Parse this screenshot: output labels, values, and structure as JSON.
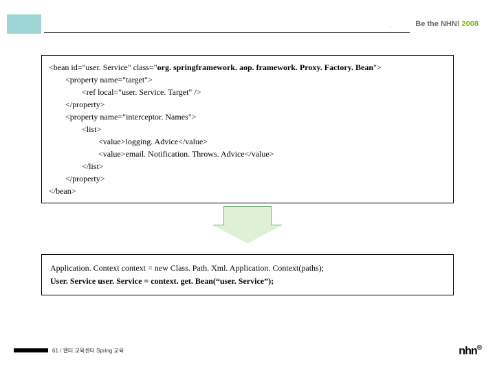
{
  "header": {
    "tag_text": "Be the NHN!",
    "year": "2008"
  },
  "code": {
    "l1_a": "<bean id=\"user. Service\" class=\"",
    "l1_b": "org. springframework. aop. framework. Proxy. Factory. Bean",
    "l1_c": "\">",
    "l2": "<property name=\"target\">",
    "l3": "<ref local=\"user. Service. Target\" />",
    "l4": "</property>",
    "l5": "<property name=\"interceptor. Names\">",
    "l6": "<list>",
    "l7": "<value>logging. Advice</value>",
    "l8": "<value>email. Notification. Throws. Advice</value>",
    "l9": "</list>",
    "l10": "</property>",
    "l11": "</bean>"
  },
  "usage": {
    "line1": "Application. Context context = new Class. Path. Xml. Application. Context(paths);",
    "line2": "User. Service user. Service = context. get. Bean(“user. Service”);"
  },
  "footer": {
    "page": "61 / 웹터 교육센터 Spring 교육",
    "logo": "nhn"
  }
}
